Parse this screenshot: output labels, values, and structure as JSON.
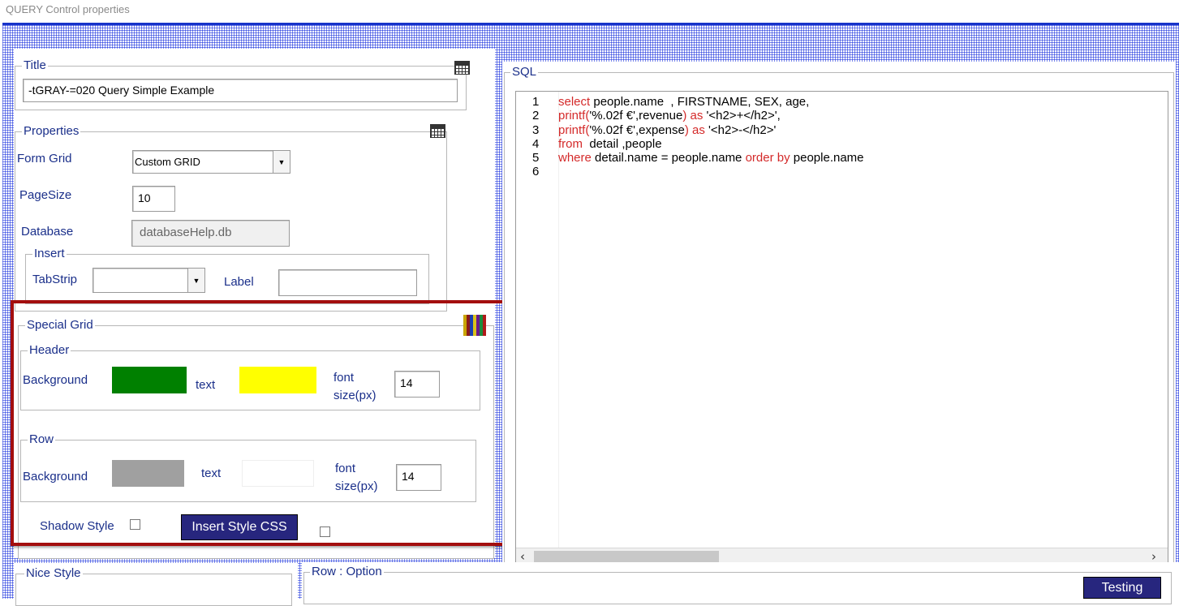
{
  "window": {
    "title": "QUERY Control properties"
  },
  "title_section": {
    "legend": "Title",
    "value": "-tGRAY-=020   Query  Simple Example",
    "icon": "table-icon"
  },
  "properties": {
    "legend": "Properties",
    "icon": "table-icon",
    "form_grid_label": "Form Grid",
    "form_grid_value": "Custom GRID",
    "pagesize_label": "PageSize",
    "pagesize_value": "10",
    "database_label": "Database",
    "database_value": "databaseHelp.db",
    "insert": {
      "legend": "Insert",
      "tabstrip_label": "TabStrip",
      "tabstrip_value": "",
      "label_label": "Label",
      "label_value": ""
    }
  },
  "special_grid": {
    "legend": "Special Grid",
    "icon": "color-palette-icon",
    "header": {
      "legend": "Header",
      "background_label": "Background",
      "background_color": "#008000",
      "text_label": "text",
      "text_color": "#ffff00",
      "font_label_1": "font",
      "font_label_2": "size(px)",
      "font_size": "14"
    },
    "row": {
      "legend": "Row",
      "background_label": "Background",
      "background_color": "#a0a0a0",
      "text_label": "text",
      "text_color": "#ffffff",
      "font_label_1": "font",
      "font_label_2": "size(px)",
      "font_size": "14"
    },
    "shadow_style_label": "Shadow Style",
    "shadow_style_checked": false,
    "insert_css_label": "Insert Style CSS",
    "extra_checked": false
  },
  "sql": {
    "legend": "SQL",
    "line_numbers": [
      "1",
      "2",
      "3",
      "4",
      "5",
      "6"
    ],
    "lines": [
      [
        {
          "t": "select",
          "k": true
        },
        {
          "t": " people.name  , FIRSTNAME, SEX, age,",
          "k": false
        }
      ],
      [
        {
          "t": "printf(",
          "k": true
        },
        {
          "t": "'%.02f €',revenue",
          "k": false
        },
        {
          "t": ") as ",
          "k": true
        },
        {
          "t": "'<h2>+</h2>',",
          "k": false
        }
      ],
      [
        {
          "t": "printf(",
          "k": true
        },
        {
          "t": "'%.02f €',expense",
          "k": false
        },
        {
          "t": ") as ",
          "k": true
        },
        {
          "t": "'<h2>-</h2>'",
          "k": false
        }
      ],
      [
        {
          "t": "from",
          "k": true
        },
        {
          "t": "  detail ,people",
          "k": false
        }
      ],
      [
        {
          "t": "where",
          "k": true
        },
        {
          "t": " detail.name = people.name ",
          "k": false
        },
        {
          "t": "order by",
          "k": true
        },
        {
          "t": " people.name",
          "k": false
        }
      ],
      []
    ]
  },
  "nice_style": {
    "legend": "Nice Style"
  },
  "row_option": {
    "legend": "Row :  Option"
  },
  "testing_label": "Testing",
  "colors": {
    "accent": "#27267e",
    "highlight": "#a30e0e",
    "label": "#1a2f8a",
    "keyword": "#d42a2a"
  }
}
